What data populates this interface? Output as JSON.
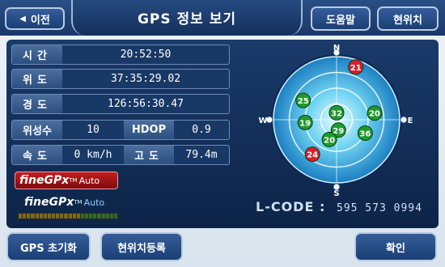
{
  "header": {
    "back_label": "이전",
    "title": "GPS 정보 보기",
    "help_label": "도움말",
    "current_location_label": "현위치"
  },
  "info": {
    "time": {
      "label": "시간",
      "value": "20:52:50"
    },
    "latitude": {
      "label": "위도",
      "value": "37:35:29.02"
    },
    "longitude": {
      "label": "경도",
      "value": "126:56:30.47"
    },
    "satellites": {
      "label": "위성수",
      "value": "10",
      "hdop_label": "HDOP",
      "hdop_value": "0.9"
    },
    "speed": {
      "label": "속도",
      "value": "0 km/h",
      "altitude_label": "고도",
      "altitude_value": "79.4m"
    }
  },
  "logos": {
    "red": {
      "fine": "fineGPx",
      "tm": "TM",
      "auto": "Auto"
    },
    "blue": {
      "fine": "fineGPx",
      "tm": "TM",
      "auto": "Auto"
    }
  },
  "compass": {
    "north": "N",
    "south": "S",
    "east": "E",
    "west": "W"
  },
  "satellites": [
    {
      "id": "21",
      "azimuth_deg": 20,
      "elevation_deg": 10,
      "color": "red"
    },
    {
      "id": "25",
      "azimuth_deg": 300,
      "elevation_deg": 35,
      "color": "green"
    },
    {
      "id": "32",
      "azimuth_deg": 0,
      "elevation_deg": 80,
      "color": "green"
    },
    {
      "id": "19",
      "azimuth_deg": 265,
      "elevation_deg": 45,
      "color": "green"
    },
    {
      "id": "20",
      "azimuth_deg": 80,
      "elevation_deg": 35,
      "color": "green"
    },
    {
      "id": "29",
      "azimuth_deg": 170,
      "elevation_deg": 75,
      "color": "green"
    },
    {
      "id": "36",
      "azimuth_deg": 115,
      "elevation_deg": 45,
      "color": "green"
    },
    {
      "id": "20",
      "azimuth_deg": 200,
      "elevation_deg": 60,
      "color": "green"
    },
    {
      "id": "24",
      "azimuth_deg": 215,
      "elevation_deg": 30,
      "color": "red"
    }
  ],
  "lcode": {
    "label": "L-CODE :",
    "value": "595 573 0994"
  },
  "signal": {
    "strength": 0.0
  },
  "footer": {
    "reset_label": "GPS 초기화",
    "register_label": "현위치등록",
    "ok_label": "확인"
  }
}
